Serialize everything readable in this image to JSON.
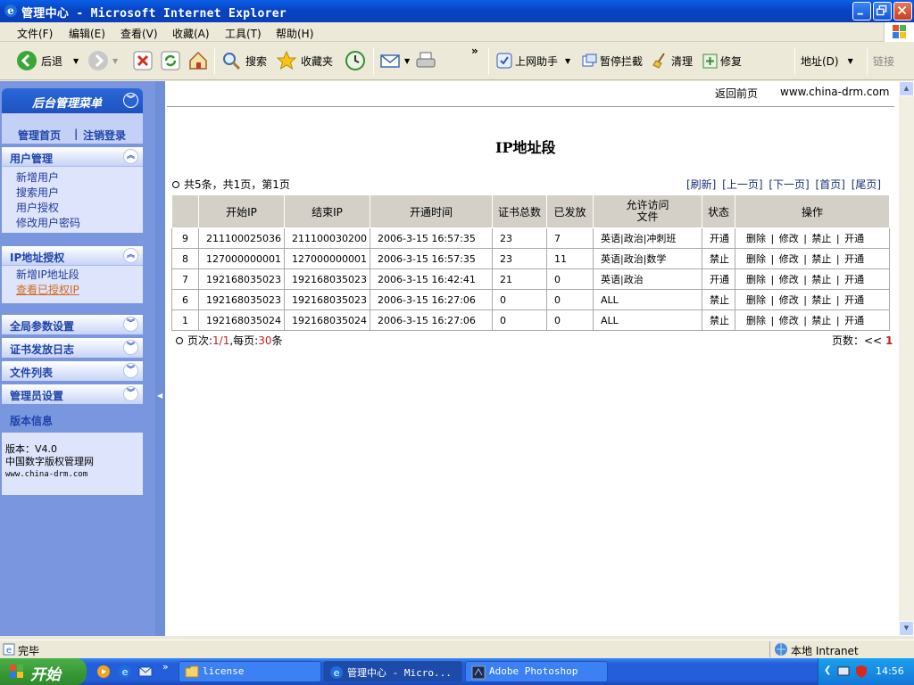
{
  "window": {
    "title": "管理中心 - Microsoft Internet Explorer"
  },
  "menu": [
    "文件(F)",
    "编辑(E)",
    "查看(V)",
    "收藏(A)",
    "工具(T)",
    "帮助(H)"
  ],
  "toolbar": {
    "back": "后退",
    "search": "搜索",
    "favorites": "收藏夹",
    "helper": "上网助手",
    "block": "暂停拦截",
    "clean": "清理",
    "repair": "修复",
    "address": "地址(D)",
    "links": "链接"
  },
  "sidebar": {
    "title": "后台管理菜单",
    "home": "管理首页",
    "logout": "注销登录",
    "user_group": {
      "title": "用户管理",
      "items": [
        "新增用户",
        "搜索用户",
        "用户授权",
        "修改用户密码"
      ]
    },
    "ip_group": {
      "title": "IP地址授权",
      "items": [
        "新增IP地址段",
        "查看已授权IP"
      ]
    },
    "collapsed": [
      "全局参数设置",
      "证书发放日志",
      "文件列表",
      "管理员设置"
    ],
    "version_head": "版本信息",
    "version": {
      "line1": "版本：V4.0",
      "line2": "中国数字版权管理网",
      "line3": "www.china-drm.com"
    }
  },
  "content": {
    "back_link": "返回前页",
    "site": "www.china-drm.com",
    "page_title": "IP地址段",
    "summary": "共5条，共1页，第1页",
    "nav": "[刷新] [上一页] [下一页] [首页] [尾页]",
    "columns": [
      "",
      "开始IP",
      "结束IP",
      "开通时间",
      "证书总数",
      "已发放",
      "允许访问\n文件",
      "状态",
      "操作"
    ],
    "rows": [
      {
        "id": "9",
        "start": "211100025036",
        "end": "211100030200",
        "time": "2006-3-15 16:57:35",
        "total": "23",
        "issued": "7",
        "files": "英语|政治|冲刺班",
        "status": "开通"
      },
      {
        "id": "8",
        "start": "127000000001",
        "end": "127000000001",
        "time": "2006-3-15 16:57:35",
        "total": "23",
        "issued": "11",
        "files": "英语|政治|数学",
        "status": "禁止"
      },
      {
        "id": "7",
        "start": "192168035023",
        "end": "192168035023",
        "time": "2006-3-15 16:42:41",
        "total": "21",
        "issued": "0",
        "files": "英语|政治",
        "status": "开通"
      },
      {
        "id": "6",
        "start": "192168035023",
        "end": "192168035023",
        "time": "2006-3-15 16:27:06",
        "total": "0",
        "issued": "0",
        "files": "ALL",
        "status": "禁止"
      },
      {
        "id": "1",
        "start": "192168035024",
        "end": "192168035024",
        "time": "2006-3-15 16:27:06",
        "total": "0",
        "issued": "0",
        "files": "ALL",
        "status": "禁止"
      }
    ],
    "actions": [
      "删除",
      "修改",
      "禁止",
      "开通"
    ],
    "footer_page_label": "页次:",
    "footer_page_value": "1/1",
    "footer_per_label": ",每页:",
    "footer_per_value": "30",
    "footer_per_unit": "条",
    "pages_label": "页数：<<",
    "pages_value": "1"
  },
  "status": {
    "left": "完毕",
    "zone": "本地 Intranet"
  },
  "taskbar": {
    "start": "开始",
    "tasks": [
      "license",
      "管理中心 - Micro...",
      "Adobe Photoshop"
    ],
    "clock": "14:56"
  }
}
